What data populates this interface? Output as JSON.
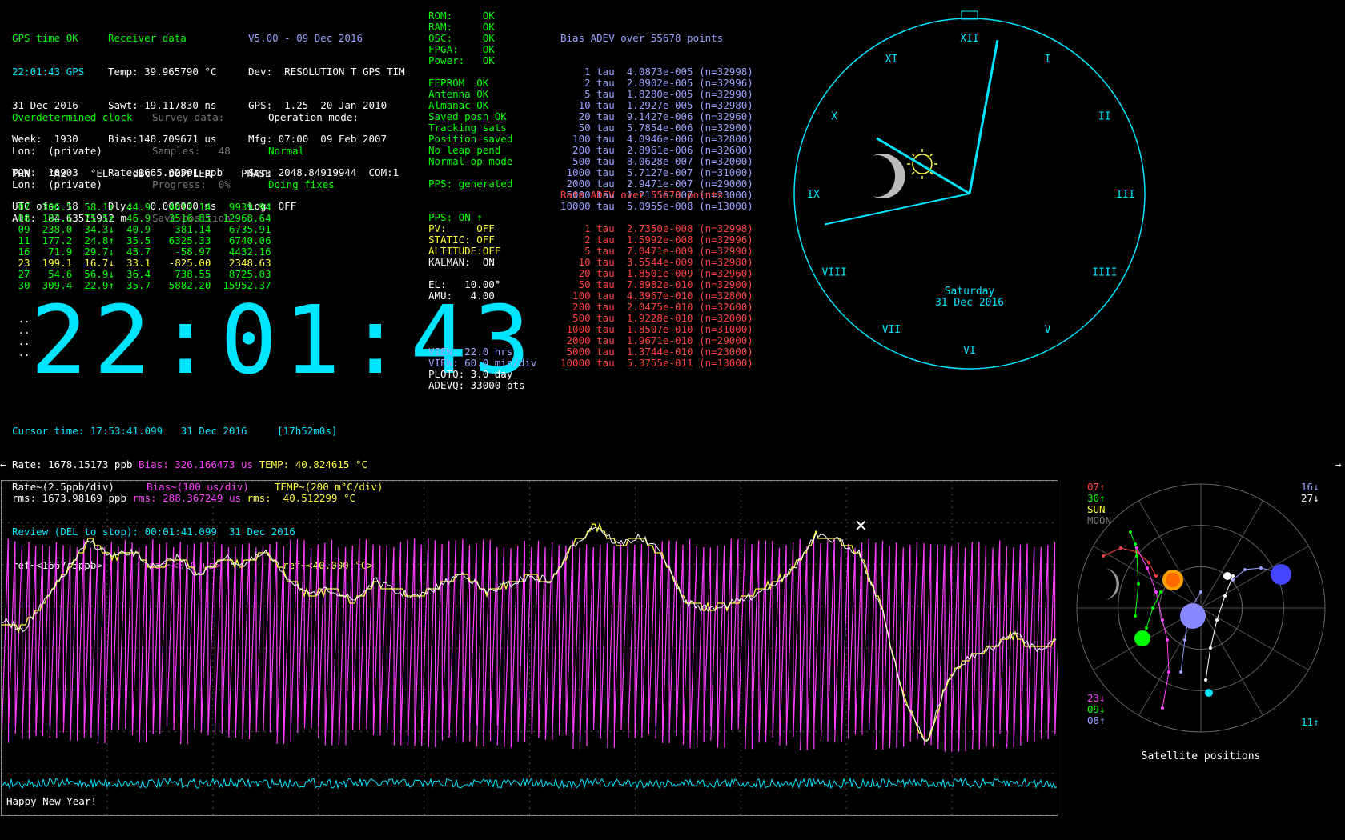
{
  "col1": {
    "status": "GPS time OK",
    "time": "22:01:43 GPS",
    "date": "31 Dec 2016",
    "week": "Week:  1930",
    "tow": "TOW:  10903",
    "utc": "UTC ofs: 18"
  },
  "col2": {
    "title": "Receiver data",
    "temp": "Temp: 39.965790 °C",
    "sawt": "Sawt:-19.117830 ns",
    "bias": "Bias:148.709671 us",
    "rate": "Rate:1665.62561 ppb",
    "dly": "Dly:   0.000000 ns"
  },
  "col3": {
    "ver": "V5.00 - 09 Dec 2016",
    "dev": "Dev:  RESOLUTION T GPS TIM",
    "gps": "GPS:  1.25  20 Jan 2010",
    "mfg": "Mfg: 07:00  09 Feb 2007",
    "ser": "Ser: 2048.84919944  COM:1",
    "log": "Log: OFF"
  },
  "posn": {
    "title": "Overdetermined clock",
    "lon1": "Lon:  (private)",
    "lon2": "Lon:  (private)",
    "alt": "Alt:  84.63511912 m"
  },
  "survey": {
    "title": "Survey data:",
    "samples": "Samples:   48",
    "progress": "Progress:  0%",
    "save": "Save position"
  },
  "opmode": {
    "title": "Operation mode:",
    "mode": "Normal",
    "fix": "Doing fixes"
  },
  "sat_header": "PRN   °AZ    °EL    dBc   DOPPLER     PHASE",
  "sats": [
    {
      "t": " 07  306.5  58.1↑  44.9   4612.14   9939.94",
      "c": "green"
    },
    {
      "t": " 08  192.1  75.5↑  46.9   3516.85  12968.64",
      "c": "green"
    },
    {
      "t": " 09  238.0  34.3↓  40.9    381.14   6735.91",
      "c": "green"
    },
    {
      "t": " 11  177.2  24.8↑  35.5   6325.33   6740.06",
      "c": "green"
    },
    {
      "t": " 16   71.9  29.7↓  43.7    -58.97   4432.16",
      "c": "green"
    },
    {
      "t": " 23  199.1  16.7↓  33.1   -825.00   2348.63",
      "c": "yellow"
    },
    {
      "t": " 27   54.6  56.9↓  36.4    738.55   8725.03",
      "c": "green"
    },
    {
      "t": " 30  309.4  22.9↑  35.7   5882.20  15952.37",
      "c": "green"
    }
  ],
  "dots": [
    " ..",
    " ..",
    " ..",
    " .."
  ],
  "bigclock": "22:01:43",
  "status": [
    {
      "t": "ROM:     OK",
      "c": "green"
    },
    {
      "t": "RAM:     OK",
      "c": "green"
    },
    {
      "t": "OSC:     OK",
      "c": "green"
    },
    {
      "t": "FPGA:    OK",
      "c": "green"
    },
    {
      "t": "Power:   OK",
      "c": "green"
    },
    {
      "t": "",
      "c": "green"
    },
    {
      "t": "EEPROM  OK",
      "c": "green"
    },
    {
      "t": "Antenna OK",
      "c": "green"
    },
    {
      "t": "Almanac OK",
      "c": "green"
    },
    {
      "t": "Saved posn OK",
      "c": "green"
    },
    {
      "t": "Tracking sats",
      "c": "green"
    },
    {
      "t": "Position saved",
      "c": "green"
    },
    {
      "t": "No leap pend",
      "c": "green"
    },
    {
      "t": "Normal op mode",
      "c": "green"
    },
    {
      "t": "",
      "c": "green"
    },
    {
      "t": "PPS: generated",
      "c": "green"
    }
  ],
  "pps": [
    {
      "t": "PPS: ON ↑",
      "c": "green"
    },
    {
      "t": "PV:     OFF",
      "c": "yellow"
    },
    {
      "t": "STATIC: OFF",
      "c": "yellow"
    },
    {
      "t": "ALTITUDE:OFF",
      "c": "yellow"
    },
    {
      "t": "KALMAN:  ON",
      "c": "white"
    },
    {
      "t": "",
      "c": "white"
    },
    {
      "t": "EL:   10.00°",
      "c": "white"
    },
    {
      "t": "AMU:   4.00",
      "c": "white"
    }
  ],
  "view": [
    {
      "t": "VIEW: 22.0 hrs",
      "c": "blue"
    },
    {
      "t": "VIEW: 60.0 min/div",
      "c": "blue"
    },
    {
      "t": "PLOTQ: 3.0 day",
      "c": "white"
    },
    {
      "t": "ADEVQ: 33000 pts",
      "c": "white"
    }
  ],
  "bias_adev": {
    "title": "Bias ADEV over 55678 points",
    "rows": [
      "    1 tau  4.0873e-005 (n=32998)",
      "    2 tau  2.8902e-005 (n=32996)",
      "    5 tau  1.8280e-005 (n=32990)",
      "   10 tau  1.2927e-005 (n=32980)",
      "   20 tau  9.1427e-006 (n=32960)",
      "   50 tau  5.7854e-006 (n=32900)",
      "  100 tau  4.0946e-006 (n=32800)",
      "  200 tau  2.8961e-006 (n=32600)",
      "  500 tau  8.0628e-007 (n=32000)",
      " 1000 tau  5.7127e-007 (n=31000)",
      " 2000 tau  2.9471e-007 (n=29000)",
      " 5000 tau  1.2151e-007 (n=23000)",
      "10000 tau  5.0955e-008 (n=13000)"
    ]
  },
  "rate_adev": {
    "title": "Rate ADEV over 55678 points",
    "rows": [
      "    1 tau  2.7350e-008 (n=32998)",
      "    2 tau  1.5992e-008 (n=32996)",
      "    5 tau  7.0471e-009 (n=32990)",
      "   10 tau  3.5544e-009 (n=32980)",
      "   20 tau  1.8501e-009 (n=32960)",
      "   50 tau  7.8982e-010 (n=32900)",
      "  100 tau  4.3967e-010 (n=32800)",
      "  200 tau  2.0475e-010 (n=32600)",
      "  500 tau  1.9228e-010 (n=32000)",
      " 1000 tau  1.8507e-010 (n=31000)",
      " 2000 tau  1.9671e-010 (n=29000)",
      " 5000 tau  1.3744e-010 (n=23000)",
      "10000 tau  5.3755e-011 (n=13000)"
    ]
  },
  "clock": {
    "day": "Saturday",
    "date": "31 Dec 2016",
    "numerals": [
      "XII",
      "I",
      "II",
      "III",
      "IIII",
      "V",
      "VI",
      "VII",
      "VIII",
      "IX",
      "X",
      "XI"
    ],
    "hour": 22.0286,
    "minute": 1.72,
    "second": 43
  },
  "cursor": {
    "line1": "Cursor time: 17:53:41.099   31 Dec 2016     [17h52m0s]",
    "rate": "Rate: 1678.15173 ppb",
    "bias": "Bias: 326.166473 us",
    "temp": "TEMP: 40.824615 °C",
    "rms": "rms: 1673.98169 ppb",
    "rms_bias": "rms: 288.367249 us",
    "rms_temp": "rms:  40.512299 °C",
    "review": "Review (DEL to stop):",
    "review_time": "00:01:41.099  31 Dec 2016",
    "ref_rate": "ref~<1667.5ppb>",
    "ref_bias": "ref~<0.0 us>",
    "ref_temp": "ref~<40.000 °C>",
    "scale_rate": "Rate~(2.5ppb/div)",
    "scale_bias": "Bias~(100 us/div)",
    "scale_temp": "TEMP~(200 m°C/div)"
  },
  "plot_msg": "Happy New Year!",
  "sky": {
    "title": "Satellite positions",
    "left_top": [
      {
        "t": "07↑",
        "c": "red"
      },
      {
        "t": "30↑",
        "c": "green"
      },
      {
        "t": "SUN",
        "c": "yellow"
      },
      {
        "t": "MOON",
        "c": "gray"
      }
    ],
    "right_top": [
      {
        "t": "16↓",
        "c": "blue"
      },
      {
        "t": "27↓",
        "c": "white"
      }
    ],
    "left_bot": [
      {
        "t": "23↓",
        "c": "mag"
      },
      {
        "t": "09↓",
        "c": "green"
      },
      {
        "t": "08↑",
        "c": "blue"
      }
    ],
    "right_bot": [
      {
        "t": "11↑",
        "c": "cyan"
      }
    ]
  },
  "colors": {
    "cyan": "#00e5ff",
    "magenta": "#ff40ff",
    "yellow": "#ffff40",
    "white": "#ffffff"
  }
}
